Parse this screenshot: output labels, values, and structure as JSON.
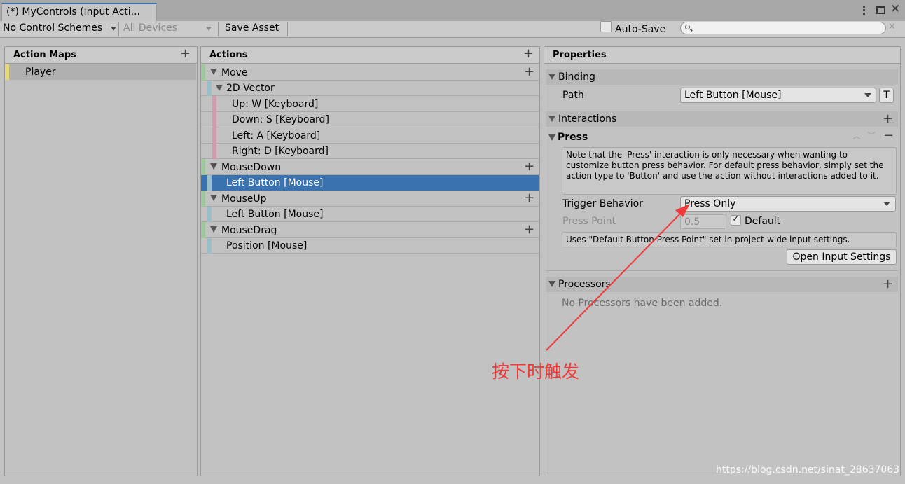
{
  "window": {
    "tab_title": "(*) MyControls (Input Acti..."
  },
  "toolbar": {
    "control_schemes": "No Control Schemes",
    "devices": "All Devices",
    "save_asset": "Save Asset",
    "auto_save": "Auto-Save",
    "search_placeholder": ""
  },
  "action_maps": {
    "header": "Action Maps",
    "items": [
      {
        "label": "Player"
      }
    ]
  },
  "actions": {
    "header": "Actions",
    "items": [
      {
        "label": "Move"
      },
      {
        "label": "2D Vector"
      },
      {
        "label": "Up: W [Keyboard]"
      },
      {
        "label": "Down: S [Keyboard]"
      },
      {
        "label": "Left: A [Keyboard]"
      },
      {
        "label": "Right: D [Keyboard]"
      },
      {
        "label": "MouseDown"
      },
      {
        "label": "Left Button [Mouse]"
      },
      {
        "label": "MouseUp"
      },
      {
        "label": "Left Button [Mouse]"
      },
      {
        "label": "MouseDrag"
      },
      {
        "label": "Position [Mouse]"
      }
    ]
  },
  "properties": {
    "header": "Properties",
    "binding": {
      "section": "Binding",
      "path_label": "Path",
      "path_value": "Left Button [Mouse]",
      "t_button": "T"
    },
    "interactions": {
      "section": "Interactions",
      "press": "Press",
      "note": "Note that the 'Press' interaction is only necessary when wanting to customize button press behavior. For default press behavior, simply set the action type to 'Button' and use the action without interactions added to it.",
      "trigger_label": "Trigger Behavior",
      "trigger_value": "Press Only",
      "press_point_label": "Press Point",
      "press_point_value": "0.5",
      "default_label": "Default",
      "uses_note": "Uses \"Default Button Press Point\" set in project-wide input settings.",
      "open_settings": "Open Input Settings"
    },
    "processors": {
      "section": "Processors",
      "empty": "No Processors have been added."
    }
  },
  "annotation": {
    "text": "按下时触发",
    "color": "#f03a3a"
  },
  "watermark": "https://blog.csdn.net/sinat_28637063",
  "colors": {
    "selection": "#3a72b0",
    "map_accent": "#e8d87a",
    "action_accent": "#9ec79a",
    "binding_accent": "#9bbfc9",
    "part_accent": "#d39ab0"
  }
}
